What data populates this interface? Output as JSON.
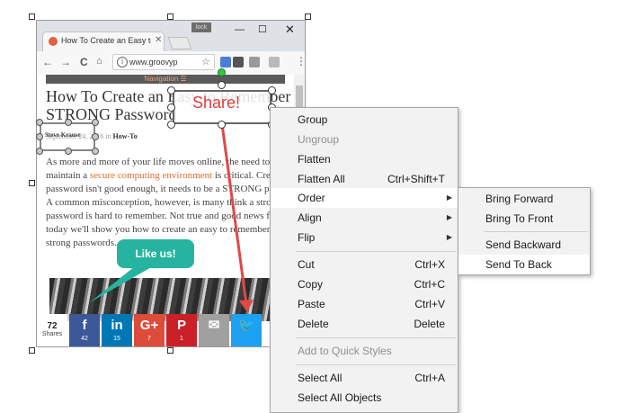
{
  "browser": {
    "tab_title": "How To Create an Easy to",
    "tab_close": "✕",
    "dark_badge": "lock",
    "win_min": "—",
    "win_max": "☐",
    "win_close": "✕",
    "back": "←",
    "forward": "→",
    "reload": "C",
    "url": "www.groovyp",
    "info": "i",
    "star": "☆",
    "menu": "⋮"
  },
  "page": {
    "nav_label": "Navigation ☰",
    "title": "How To Create an Easy to Remember STRONG Password",
    "byline_author": "Steve Krause",
    "byline_date": "September 24, 2016 in ",
    "byline_category": "How-To",
    "body_1": "As more and more of your life moves online, the need to maintain a ",
    "body_link": "secure computing environment",
    "body_2": " is critical. Creating a password isn't good enough, it needs to be a STRONG password. A common misconception, however, is many think a strong password is hard to remember. Not true and good news for you, today we'll show you how to create an easy to remember, yet strong passwords."
  },
  "share": {
    "count": "72",
    "count_label": "Shares",
    "buttons": [
      {
        "icon": "f",
        "count": "42",
        "color": "#3b5998",
        "name": "facebook"
      },
      {
        "icon": "in",
        "count": "15",
        "color": "#0077b5",
        "name": "linkedin"
      },
      {
        "icon": "G+",
        "count": "7",
        "color": "#dd4b39",
        "name": "googleplus"
      },
      {
        "icon": "P",
        "count": "1",
        "color": "#cb2027",
        "name": "pinterest"
      },
      {
        "icon": "✉",
        "count": "",
        "color": "#a0a0a0",
        "name": "email"
      },
      {
        "icon": "🐦",
        "count": "",
        "color": "#1da1f2",
        "name": "twitter"
      }
    ]
  },
  "annotations": {
    "share_label": "Share!",
    "author_label": "Steve Krause",
    "bubble_label": "Like us!"
  },
  "context_menu": {
    "items": [
      {
        "label": "Group",
        "shortcut": "",
        "disabled": false
      },
      {
        "label": "Ungroup",
        "shortcut": "",
        "disabled": true
      },
      {
        "label": "Flatten",
        "shortcut": "",
        "disabled": false
      },
      {
        "label": "Flatten All",
        "shortcut": "Ctrl+Shift+T",
        "disabled": false
      },
      {
        "label": "Order",
        "shortcut": "",
        "submenu": true,
        "highlighted": true
      },
      {
        "label": "Align",
        "shortcut": "",
        "submenu": true
      },
      {
        "label": "Flip",
        "shortcut": "",
        "submenu": true
      },
      {
        "label": "Cut",
        "shortcut": "Ctrl+X"
      },
      {
        "label": "Copy",
        "shortcut": "Ctrl+C"
      },
      {
        "label": "Paste",
        "shortcut": "Ctrl+V"
      },
      {
        "label": "Delete",
        "shortcut": "Delete"
      },
      {
        "label": "Add to Quick Styles",
        "shortcut": "",
        "disabled": true
      },
      {
        "label": "Select All",
        "shortcut": "Ctrl+A"
      },
      {
        "label": "Select All Objects",
        "shortcut": ""
      }
    ],
    "submenu_arrow": "▶"
  },
  "order_submenu": {
    "items": [
      {
        "label": "Bring Forward"
      },
      {
        "label": "Bring To Front"
      },
      {
        "label": "Send Backward"
      },
      {
        "label": "Send To Back",
        "highlighted": true
      }
    ]
  }
}
